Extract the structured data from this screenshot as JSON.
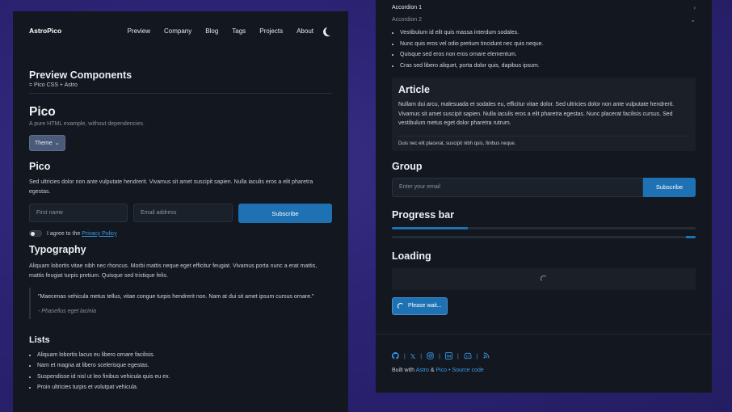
{
  "nav": {
    "brand": "AstroPico",
    "links": [
      "Preview",
      "Company",
      "Blog",
      "Tags",
      "Projects",
      "About"
    ]
  },
  "preview": {
    "title": "Preview Components",
    "subtitle": "= Pico CSS + Astro"
  },
  "pico": {
    "title": "Pico",
    "subtitle": "A pure HTML example, without dependencies.",
    "theme_button": "Theme"
  },
  "form": {
    "title": "Pico",
    "text": "Sed ultricies dolor non ante vulputate hendrerit. Vivamus sit amet suscipit sapien. Nulla iaculis eros a elit pharetra egestas.",
    "first_name_placeholder": "First name",
    "email_placeholder": "Email address",
    "subscribe": "Subscribe",
    "agree_text": "I agree to the",
    "privacy_link": "Privacy Policy"
  },
  "typography": {
    "title": "Typography",
    "text": "Aliquam lobortis vitae nibh nec rhoncus. Morbi mattis neque eget efficitur feugiat. Vivamus porta nunc a erat mattis, mattis feugiat turpis pretium. Quisque sed tristique felis.",
    "quote": "\"Maecenas vehicula metus tellus, vitae congue turpis hendrerit non. Nam at dui sit amet ipsum cursus ornare.\"",
    "cite": "- Phasellus eget lacinia"
  },
  "lists": {
    "title": "Lists",
    "items": [
      "Aliquam lobortis lacus eu libero ornare facilisis.",
      "Nam et magna at libero scelerisque egestas.",
      "Suspendisse id nisl ut leo finibus vehicula quis eu ex.",
      "Proin ultricies turpis et volutpat vehicula."
    ]
  },
  "accordion": {
    "items": [
      "Accordion 1",
      "Accordion 2"
    ],
    "list": [
      "Vestibulum id elit quis massa interdum sodales.",
      "Nunc quis eros vel odio pretium tincidunt nec quis neque.",
      "Quisque sed eros non eros ornare elementum.",
      "Cras sed libero aliquet, porta dolor quis, dapibus ipsum."
    ]
  },
  "article": {
    "title": "Article",
    "body": "Nullam dui arcu, malesuada et sodales eu, efficitur vitae dolor. Sed ultricies dolor non ante vulputate hendrerit. Vivamus sit amet suscipit sapien. Nulla iaculis eros a elit pharetra egestas. Nunc placerat facilisis cursus. Sed vestibulum metus eget dolor pharetra rutrum.",
    "footer": "Duis nec elit placerat, suscipit nibh quis, finibus neque."
  },
  "group": {
    "title": "Group",
    "email_placeholder": "Enter your email",
    "subscribe": "Subscribe"
  },
  "progress": {
    "title": "Progress bar",
    "value": 0.25
  },
  "loading": {
    "title": "Loading",
    "button": "Please wait..."
  },
  "footer": {
    "icons": [
      "github-icon",
      "x-icon",
      "instagram-icon",
      "linkedin-icon",
      "discord-icon",
      "rss-icon"
    ],
    "built_prefix": "Built with",
    "astro": "Astro",
    "amp": "&",
    "pico": "Pico",
    "dot": "•",
    "source": "Source code"
  },
  "colors": {
    "accent": "#1e71b3",
    "link": "#3b9be8",
    "panel": "#13171f",
    "background": "#2c2374"
  }
}
